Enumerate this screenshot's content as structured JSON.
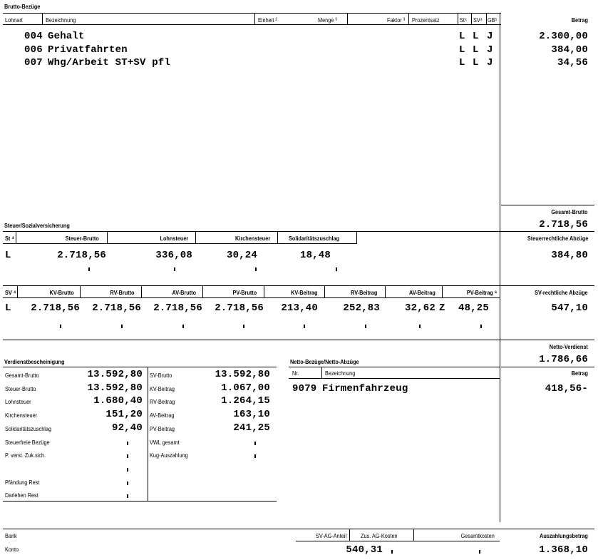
{
  "brutto": {
    "section_title": "Brutto-Bezüge",
    "headers": {
      "lohnart": "Lohnart",
      "bezeichnung": "Bezeichnung",
      "einheit": "Einheit ²",
      "menge": "Menge ³",
      "faktor": "Faktor ³",
      "prozentsatz": "Prozentsatz",
      "st": "St⁴",
      "sv": "SV⁴",
      "gb": "GB⁵",
      "betrag": "Betrag"
    },
    "rows": [
      {
        "nr": "004",
        "name": "Gehalt",
        "st": "L",
        "sv": "L",
        "gb": "J",
        "betrag": "2.300,00"
      },
      {
        "nr": "006",
        "name": "Privatfahrten",
        "st": "L",
        "sv": "L",
        "gb": "J",
        "betrag": "384,00"
      },
      {
        "nr": "007",
        "name": "Whg/Arbeit ST+SV pfl",
        "st": "L",
        "sv": "L",
        "gb": "J",
        "betrag": "34,56"
      }
    ],
    "gesamt_label": "Gesamt-Brutto",
    "gesamt_value": "2.718,56"
  },
  "steuer": {
    "section_title": "Steuer/Sozialversicherung",
    "headers": {
      "st": "St ⁴",
      "steuer_brutto": "Steuer-Brutto",
      "lohnsteuer": "Lohnsteuer",
      "kirchensteuer": "Kirchensteuer",
      "soli": "Solidaritätszuschlag"
    },
    "values": {
      "st": "L",
      "steuer_brutto": "2.718,56",
      "lohnsteuer": "336,08",
      "kirchensteuer": "30,24",
      "soli": "18,48"
    },
    "abzuege_label": "Steuerrechtliche Abzüge",
    "abzuege_value": "384,80"
  },
  "sv": {
    "headers": {
      "sv": "SV ⁴",
      "kv_brutto": "KV-Brutto",
      "rv_brutto": "RV-Brutto",
      "av_brutto": "AV-Brutto",
      "pv_brutto": "PV-Brutto",
      "kv_beitrag": "KV-Beitrag",
      "rv_beitrag": "RV-Beitrag",
      "av_beitrag": "AV-Beitrag",
      "pv_beitrag": "PV-Beitrag ⁶"
    },
    "values": {
      "sv": "L",
      "kv_brutto": "2.718,56",
      "rv_brutto": "2.718,56",
      "av_brutto": "2.718,56",
      "pv_brutto": "2.718,56",
      "kv_beitrag": "213,40",
      "rv_beitrag": "252,83",
      "av_beitrag": "32,62",
      "av_flag": "Z",
      "pv_beitrag": "48,25"
    },
    "abzuege_label": "SV-rechtliche Abzüge",
    "abzuege_value": "547,10"
  },
  "netto": {
    "verdienst_label": "Netto-Verdienst",
    "verdienst_value": "1.786,66",
    "section_title": "Netto-Bezüge/Netto-Abzüge",
    "headers": {
      "nr": "Nr.",
      "bezeichnung": "Bezeichnung",
      "betrag": "Betrag"
    },
    "rows": [
      {
        "nr": "9079",
        "name": "Firmenfahrzeug",
        "betrag": "418,56-"
      }
    ]
  },
  "verdienst": {
    "section_title": "Verdienstbescheinigung",
    "left": [
      {
        "label": "Gesamt-Brutto",
        "value": "13.592,80"
      },
      {
        "label": "Steuer-Brutto",
        "value": "13.592,80"
      },
      {
        "label": "Lohnsteuer",
        "value": "1.680,40"
      },
      {
        "label": "Kirchensteuer",
        "value": "151,20"
      },
      {
        "label": "Solidaritätszuschlag",
        "value": "92,40"
      },
      {
        "label": "Steuerfreie Bezüge",
        "value": ""
      },
      {
        "label": "P. verst. Zuk.sich.",
        "value": ""
      },
      {
        "label": "",
        "value": ""
      },
      {
        "label": "Pfändung Rest",
        "value": ""
      },
      {
        "label": "Darlehen Rest",
        "value": ""
      }
    ],
    "right": [
      {
        "label": "SV-Brutto",
        "value": "13.592,80"
      },
      {
        "label": "KV-Beitrag",
        "value": "1.067,00"
      },
      {
        "label": "RV-Beitrag",
        "value": "1.264,15"
      },
      {
        "label": "AV-Beitrag",
        "value": "163,10"
      },
      {
        "label": "PV-Beitrag",
        "value": "241,25"
      },
      {
        "label": "VWL gesamt",
        "value": ""
      },
      {
        "label": "Kug-Auszahlung",
        "value": ""
      }
    ]
  },
  "footer": {
    "bank_label": "Bank",
    "konto_label": "Konto",
    "sv_ag_anteil_label": "SV-AG-Anteil",
    "sv_ag_anteil_value": "540,31",
    "zus_ag_kosten_label": "Zus. AG-Kosten",
    "gesamtkosten_label": "Gesamtkosten",
    "auszahlung_label": "Auszahlungsbetrag",
    "auszahlung_value": "1.368,10"
  }
}
